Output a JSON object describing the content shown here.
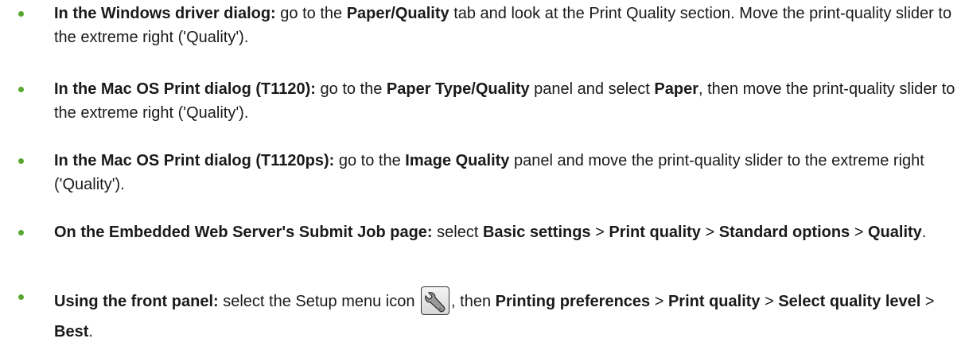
{
  "items": [
    {
      "parts": [
        {
          "b": true,
          "t": "In the Windows driver dialog:"
        },
        {
          "b": false,
          "t": " go to the "
        },
        {
          "b": true,
          "t": "Paper/Quality"
        },
        {
          "b": false,
          "t": " tab and look at the Print Quality section. Move the print-quality slider to the extreme right ('Quality')."
        }
      ]
    },
    {
      "parts": [
        {
          "b": true,
          "t": "In the Mac OS Print dialog (T1120):"
        },
        {
          "b": false,
          "t": " go to the "
        },
        {
          "b": true,
          "t": "Paper Type/Quality"
        },
        {
          "b": false,
          "t": " panel and select "
        },
        {
          "b": true,
          "t": "Paper"
        },
        {
          "b": false,
          "t": ", then move the print-quality slider to the extreme right ('Quality')."
        }
      ]
    },
    {
      "parts": [
        {
          "b": true,
          "t": "In the Mac OS Print dialog (T1120ps):"
        },
        {
          "b": false,
          "t": " go to the "
        },
        {
          "b": true,
          "t": "Image Quality"
        },
        {
          "b": false,
          "t": " panel and move the print-quality slider to the extreme right ('Quality')."
        }
      ]
    },
    {
      "parts": [
        {
          "b": true,
          "t": "On the Embedded Web Server's Submit Job page:"
        },
        {
          "b": false,
          "t": " select "
        },
        {
          "b": true,
          "t": "Basic settings"
        },
        {
          "b": false,
          "t": " > "
        },
        {
          "b": true,
          "t": "Print quality"
        },
        {
          "b": false,
          "t": " > "
        },
        {
          "b": true,
          "t": "Standard options"
        },
        {
          "b": false,
          "t": " > "
        },
        {
          "b": true,
          "t": "Quality"
        },
        {
          "b": false,
          "t": "."
        }
      ]
    }
  ],
  "front_panel": {
    "lead": "Using the front panel:",
    "text1": " select the Setup menu icon ",
    "icon": "setup-wrench-icon",
    "text2": ", then ",
    "p1": "Printing preferences",
    "sep1": " > ",
    "p2": "Print quality",
    "sep2": " > ",
    "p3": "Select quality level",
    "sep3": " > ",
    "p4": "Best",
    "end": "."
  },
  "colors": {
    "bullet": "#5aa832",
    "text": "#1a1a1a"
  }
}
